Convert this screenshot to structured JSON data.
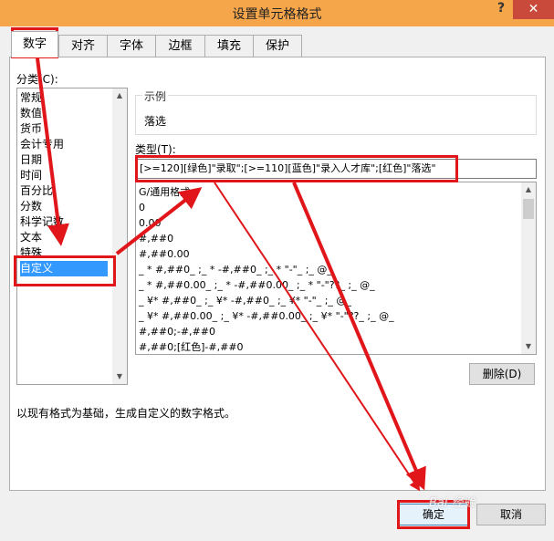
{
  "window": {
    "title": "设置单元格格式",
    "help": "?",
    "close": "✕"
  },
  "tabs": [
    "数字",
    "对齐",
    "字体",
    "边框",
    "填充",
    "保护"
  ],
  "category": {
    "label": "分类(C):",
    "items": [
      "常规",
      "数值",
      "货币",
      "会计专用",
      "日期",
      "时间",
      "百分比",
      "分数",
      "科学记数",
      "文本",
      "特殊",
      "自定义"
    ],
    "selected": "自定义"
  },
  "sample": {
    "label": "示例",
    "value": "落选"
  },
  "type": {
    "label": "类型(T):",
    "value": "[>=120][绿色]\"录取\";[>=110][蓝色]\"录入人才库\";[红色]\"落选\""
  },
  "formats": [
    "G/通用格式",
    "0",
    "0.00",
    "#,##0",
    "#,##0.00",
    "_ * #,##0_ ;_ * -#,##0_ ;_ * \"-\"_ ;_ @_",
    "_ * #,##0.00_ ;_ * -#,##0.00_ ;_ * \"-\"??_ ;_ @_",
    "_ ¥* #,##0_ ;_ ¥* -#,##0_ ;_ ¥* \"-\"_ ;_ @_",
    "_ ¥* #,##0.00_ ;_ ¥* -#,##0.00_ ;_ ¥* \"-\"??_ ;_ @_",
    "#,##0;-#,##0",
    "#,##0;[红色]-#,##0"
  ],
  "delete_button": "删除(D)",
  "description": "以现有格式为基础，生成自定义的数字格式。",
  "ok_button": "确定",
  "cancel_button": "取消",
  "watermark": "Bai 经验",
  "colors": {
    "title_bar": "#f5a54a",
    "close_button": "#c94a3a",
    "highlight": "#e0161a",
    "selection": "#3399ff"
  }
}
